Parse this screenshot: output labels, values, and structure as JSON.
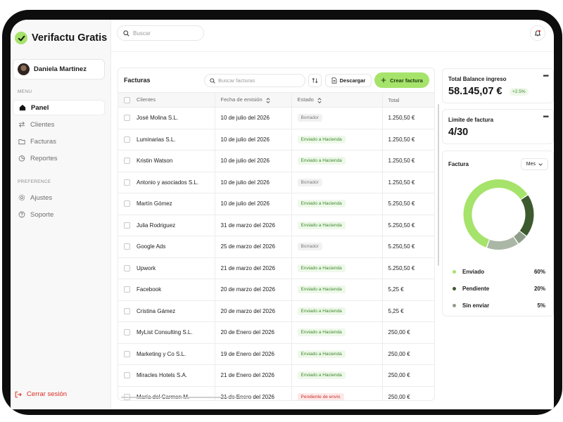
{
  "app": {
    "name": "Verifactu Gratis"
  },
  "user": {
    "name": "Daniela Martinez"
  },
  "sidebar": {
    "menu_label": "MENU",
    "items": [
      {
        "label": "Panel",
        "icon": "home-icon",
        "active": true
      },
      {
        "label": "Clientes",
        "icon": "arrows-icon",
        "active": false
      },
      {
        "label": "Facturas",
        "icon": "folder-icon",
        "active": false
      },
      {
        "label": "Reportes",
        "icon": "pie-chart-icon",
        "active": false
      }
    ],
    "preference_label": "PREFERENCE",
    "pref_items": [
      {
        "label": "Ajustes",
        "icon": "gear-icon"
      },
      {
        "label": "Soporte",
        "icon": "help-icon"
      }
    ],
    "logout_label": "Cerrar sesión"
  },
  "topbar": {
    "search_placeholder": "Buscar"
  },
  "invoices": {
    "title": "Facturas",
    "search_placeholder": "Buscar facturas",
    "download_label": "Descargar",
    "create_label": "Crear factura",
    "columns": [
      "Clientes",
      "Fecha de emisión",
      "Estado",
      "Total"
    ],
    "rows": [
      {
        "client": "José Molina S.L.",
        "date": "10 de julio del 2026",
        "status": "Borrador",
        "status_type": "draft",
        "total": "1.250,50 €"
      },
      {
        "client": "Luminarias S.L.",
        "date": "10 de julio del 2026",
        "status": "Enviado a Hacienda",
        "status_type": "sent",
        "total": "1.250,50 €"
      },
      {
        "client": "Kristin Watson",
        "date": "10 de julio del 2026",
        "status": "Enviado a Hacienda",
        "status_type": "sent",
        "total": "1.250,50 €"
      },
      {
        "client": "Antonio y asociados S.L.",
        "date": "10 de julio del 2026",
        "status": "Borrador",
        "status_type": "draft",
        "total": "1.250,50 €"
      },
      {
        "client": "Martín Gómez",
        "date": "10 de julio del 2026",
        "status": "Enviado a Hacienda",
        "status_type": "sent",
        "total": "5.250,50 €"
      },
      {
        "client": "Julia Rodriguez",
        "date": "31 de marzo del 2026",
        "status": "Enviado a Hacienda",
        "status_type": "sent",
        "total": "5.250,50 €"
      },
      {
        "client": "Google Ads",
        "date": "25 de marzo del 2026",
        "status": "Borrador",
        "status_type": "draft",
        "total": "5.250,50 €"
      },
      {
        "client": "Upwork",
        "date": "21 de marzo del 2026",
        "status": "Enviado a Hacienda",
        "status_type": "sent",
        "total": "5.250,50 €"
      },
      {
        "client": "Facebook",
        "date": "20 de marzo del 2026",
        "status": "Enviado a Hacienda",
        "status_type": "sent",
        "total": "5,25 €"
      },
      {
        "client": "Cristina Gámez",
        "date": "20 de marzo del 2026",
        "status": "Enviado a Hacienda",
        "status_type": "sent",
        "total": "5,25 €"
      },
      {
        "client": "MyList Consulting S.L.",
        "date": "20 de Enero del 2026",
        "status": "Enviado a Hacienda",
        "status_type": "sent",
        "total": "250,00 €"
      },
      {
        "client": "Marketing y Co S.L.",
        "date": "19 de Enero del 2026",
        "status": "Enviado a Hacienda",
        "status_type": "sent",
        "total": "250,00 €"
      },
      {
        "client": "Miracles Hotels S.A.",
        "date": "21 de Enero del 2026",
        "status": "Enviado a Hacienda",
        "status_type": "sent",
        "total": "250,00 €"
      },
      {
        "client": "María del Carmen M.",
        "date": "21 de Enero del 2026",
        "status": "Pendiente de envío",
        "status_type": "pending",
        "total": "250,00 €"
      }
    ]
  },
  "balance_card": {
    "label": "Total Balance ingreso",
    "value": "58.145,07 €",
    "delta": "+2.5%"
  },
  "limit_card": {
    "label": "Limite de factura",
    "value": "4/30"
  },
  "invoice_chart_card": {
    "label": "Factura",
    "period": "Mes"
  },
  "chart_data": {
    "type": "pie",
    "donut": true,
    "categories": [
      "Enviado",
      "Pendiente",
      "Sin enviar"
    ],
    "values": [
      60,
      20,
      5
    ],
    "labels": [
      "60%",
      "20%",
      "5%"
    ],
    "colors": [
      "#a6e36b",
      "#3d5a2f",
      "#8f9e8a"
    ],
    "extra_segment_colors": [
      "#aab7a6"
    ]
  },
  "colors": {
    "accent": "#a6e36b",
    "danger": "#d93025",
    "sent": "#3c8a2a"
  }
}
